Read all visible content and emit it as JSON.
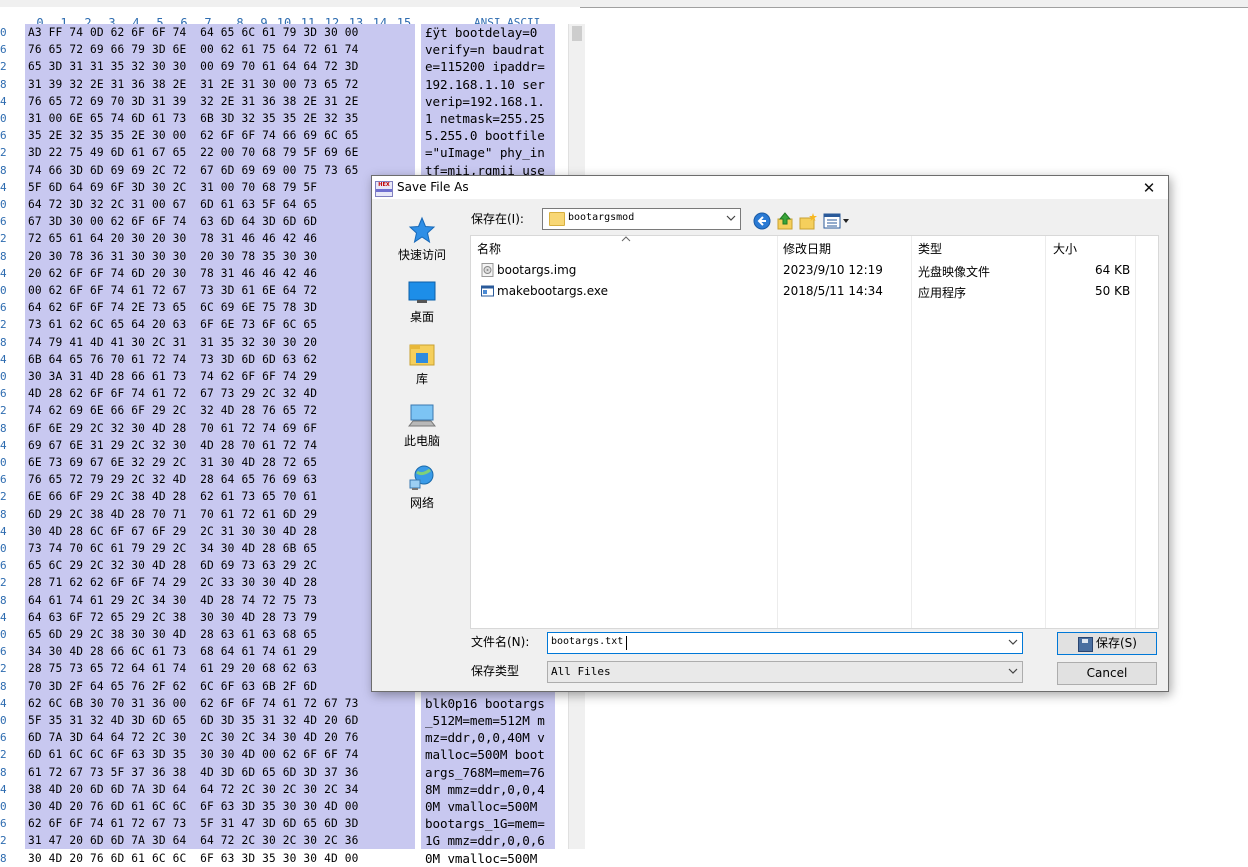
{
  "hex_editor": {
    "column_headers": [
      "0",
      "1",
      "2",
      "3",
      "4",
      "5",
      "6",
      "7",
      "8",
      "9",
      "10",
      "11",
      "12",
      "13",
      "14",
      "15"
    ],
    "ansi_header": "ANSI ASCII",
    "rows": [
      {
        "offset": "0",
        "hex": "A3 FF 74 0D 62 6F 6F 74  64 65 6C 61 79 3D 30 00",
        "ascii": "£ÿt bootdelay=0"
      },
      {
        "offset": "6",
        "hex": "76 65 72 69 66 79 3D 6E  00 62 61 75 64 72 61 74",
        "ascii": "verify=n baudrat"
      },
      {
        "offset": "2",
        "hex": "65 3D 31 31 35 32 30 30  00 69 70 61 64 64 72 3D",
        "ascii": "e=115200 ipaddr="
      },
      {
        "offset": "8",
        "hex": "31 39 32 2E 31 36 38 2E  31 2E 31 30 00 73 65 72",
        "ascii": "192.168.1.10 ser"
      },
      {
        "offset": "4",
        "hex": "76 65 72 69 70 3D 31 39  32 2E 31 36 38 2E 31 2E",
        "ascii": "verip=192.168.1."
      },
      {
        "offset": "0",
        "hex": "31 00 6E 65 74 6D 61 73  6B 3D 32 35 35 2E 32 35",
        "ascii": "1 netmask=255.25"
      },
      {
        "offset": "6",
        "hex": "35 2E 32 35 35 2E 30 00  62 6F 6F 74 66 69 6C 65",
        "ascii": "5.255.0 bootfile"
      },
      {
        "offset": "2",
        "hex": "3D 22 75 49 6D 61 67 65  22 00 70 68 79 5F 69 6E",
        "ascii": "=\"uImage\" phy_in"
      },
      {
        "offset": "8",
        "hex": "74 66 3D 6D 69 69 2C 72  67 6D 69 69 00 75 73 65",
        "ascii": "tf=mii,rgmii use"
      },
      {
        "offset": "4",
        "hex": "5F 6D 64 69 6F 3D 30 2C  31 00 70 68 79 5F",
        "ascii": ""
      },
      {
        "offset": "0",
        "hex": "64 72 3D 32 2C 31 00 67  6D 61 63 5F 64 65",
        "ascii": ""
      },
      {
        "offset": "6",
        "hex": "67 3D 30 00 62 6F 6F 74  63 6D 64 3D 6D 6D",
        "ascii": ""
      },
      {
        "offset": "2",
        "hex": "72 65 61 64 20 30 20 30  78 31 46 46 42 46",
        "ascii": ""
      },
      {
        "offset": "8",
        "hex": "20 30 78 36 31 30 30 30  20 30 78 35 30 30",
        "ascii": ""
      },
      {
        "offset": "4",
        "hex": "20 62 6F 6F 74 6D 20 30  78 31 46 46 42 46",
        "ascii": ""
      },
      {
        "offset": "0",
        "hex": "00 62 6F 6F 74 61 72 67  73 3D 61 6E 64 72",
        "ascii": ""
      },
      {
        "offset": "6",
        "hex": "64 62 6F 6F 74 2E 73 65  6C 69 6E 75 78 3D",
        "ascii": ""
      },
      {
        "offset": "2",
        "hex": "73 61 62 6C 65 64 20 63  6F 6E 73 6F 6C 65",
        "ascii": ""
      },
      {
        "offset": "8",
        "hex": "74 79 41 4D 41 30 2C 31  31 35 32 30 30 20",
        "ascii": ""
      },
      {
        "offset": "4",
        "hex": "6B 64 65 76 70 61 72 74  73 3D 6D 6D 63 62",
        "ascii": ""
      },
      {
        "offset": "0",
        "hex": "30 3A 31 4D 28 66 61 73  74 62 6F 6F 74 29",
        "ascii": ""
      },
      {
        "offset": "6",
        "hex": "4D 28 62 6F 6F 74 61 72  67 73 29 2C 32 4D",
        "ascii": ""
      },
      {
        "offset": "2",
        "hex": "74 62 69 6E 66 6F 29 2C  32 4D 28 76 65 72",
        "ascii": ""
      },
      {
        "offset": "8",
        "hex": "6F 6E 29 2C 32 30 4D 28  70 61 72 74 69 6F",
        "ascii": ""
      },
      {
        "offset": "4",
        "hex": "69 67 6E 31 29 2C 32 30  4D 28 70 61 72 74",
        "ascii": ""
      },
      {
        "offset": "0",
        "hex": "6E 73 69 67 6E 32 29 2C  31 30 4D 28 72 65",
        "ascii": ""
      },
      {
        "offset": "6",
        "hex": "76 65 72 79 29 2C 32 4D  28 64 65 76 69 63",
        "ascii": ""
      },
      {
        "offset": "2",
        "hex": "6E 66 6F 29 2C 38 4D 28  62 61 73 65 70 61",
        "ascii": ""
      },
      {
        "offset": "8",
        "hex": "6D 29 2C 38 4D 28 70 71  70 61 72 61 6D 29",
        "ascii": ""
      },
      {
        "offset": "4",
        "hex": "30 4D 28 6C 6F 67 6F 29  2C 31 30 30 4D 28",
        "ascii": ""
      },
      {
        "offset": "0",
        "hex": "73 74 70 6C 61 79 29 2C  34 30 4D 28 6B 65",
        "ascii": ""
      },
      {
        "offset": "6",
        "hex": "65 6C 29 2C 32 30 4D 28  6D 69 73 63 29 2C",
        "ascii": ""
      },
      {
        "offset": "2",
        "hex": "28 71 62 62 6F 6F 74 29  2C 33 30 30 4D 28",
        "ascii": ""
      },
      {
        "offset": "8",
        "hex": "64 61 74 61 29 2C 34 30  4D 28 74 72 75 73",
        "ascii": ""
      },
      {
        "offset": "4",
        "hex": "64 63 6F 72 65 29 2C 38  30 30 4D 28 73 79",
        "ascii": ""
      },
      {
        "offset": "0",
        "hex": "65 6D 29 2C 38 30 30 4D  28 63 61 63 68 65",
        "ascii": ""
      },
      {
        "offset": "6",
        "hex": "34 30 4D 28 66 6C 61 73  68 64 61 74 61 29",
        "ascii": ""
      },
      {
        "offset": "2",
        "hex": "28 75 73 65 72 64 61 74  61 29 20 68 62 63",
        "ascii": ""
      },
      {
        "offset": "8",
        "hex": "70 3D 2F 64 65 76 2F 62  6C 6F 63 6B 2F 6D",
        "ascii": ""
      },
      {
        "offset": "4",
        "hex": "62 6C 6B 30 70 31 36 00  62 6F 6F 74 61 72 67 73",
        "ascii": "blk0p16 bootargs"
      },
      {
        "offset": "0",
        "hex": "5F 35 31 32 4D 3D 6D 65  6D 3D 35 31 32 4D 20 6D",
        "ascii": "_512M=mem=512M m"
      },
      {
        "offset": "6",
        "hex": "6D 7A 3D 64 64 72 2C 30  2C 30 2C 34 30 4D 20 76",
        "ascii": "mz=ddr,0,0,40M v"
      },
      {
        "offset": "2",
        "hex": "6D 61 6C 6C 6F 63 3D 35  30 30 4D 00 62 6F 6F 74",
        "ascii": "malloc=500M boot"
      },
      {
        "offset": "8",
        "hex": "61 72 67 73 5F 37 36 38  4D 3D 6D 65 6D 3D 37 36",
        "ascii": "args_768M=mem=76"
      },
      {
        "offset": "4",
        "hex": "38 4D 20 6D 6D 7A 3D 64  64 72 2C 30 2C 30 2C 34",
        "ascii": "8M mmz=ddr,0,0,4"
      },
      {
        "offset": "0",
        "hex": "30 4D 20 76 6D 61 6C 6C  6F 63 3D 35 30 30 4D 00",
        "ascii": "0M vmalloc=500M"
      },
      {
        "offset": "6",
        "hex": "62 6F 6F 74 61 72 67 73  5F 31 47 3D 6D 65 6D 3D",
        "ascii": "bootargs_1G=mem="
      },
      {
        "offset": "2",
        "hex": "31 47 20 6D 6D 7A 3D 64  64 72 2C 30 2C 30 2C 36",
        "ascii": "1G mmz=ddr,0,0,6"
      },
      {
        "offset": "8",
        "hex": "30 4D 20 76 6D 61 6C 6C  6F 63 3D 35 30 30 4D 00",
        "ascii": "0M vmalloc=500M"
      }
    ]
  },
  "dialog": {
    "title": "Save File As",
    "app_icon_text": "HEX",
    "close_glyph": "✕",
    "save_in_label": "保存在(I):",
    "folder": "bootargsmod",
    "places": [
      {
        "label": "快速访问",
        "icon": "star-icon"
      },
      {
        "label": "桌面",
        "icon": "desktop-icon"
      },
      {
        "label": "库",
        "icon": "library-icon"
      },
      {
        "label": "此电脑",
        "icon": "computer-icon"
      },
      {
        "label": "网络",
        "icon": "network-icon"
      }
    ],
    "columns": {
      "name": "名称",
      "date": "修改日期",
      "type": "类型",
      "size": "大小"
    },
    "files": [
      {
        "name": "bootargs.img",
        "date": "2023/9/10 12:19",
        "type": "光盘映像文件",
        "size": "64 KB",
        "icon": "disc-image-icon"
      },
      {
        "name": "makebootargs.exe",
        "date": "2018/5/11 14:34",
        "type": "应用程序",
        "size": "50 KB",
        "icon": "application-icon"
      }
    ],
    "filename_label": "文件名(N):",
    "filename_value": "bootargs.txt",
    "filetype_label": "保存类型",
    "filetype_value": "All Files",
    "save_button": "保存(S)",
    "cancel_button": "Cancel"
  }
}
